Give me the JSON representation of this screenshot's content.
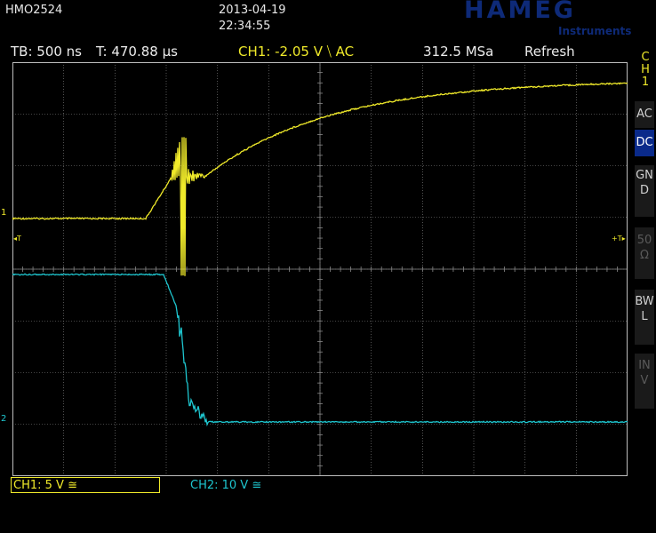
{
  "header": {
    "model": "HMO2524",
    "date": "2013-04-19",
    "time": "22:34:55",
    "brand": "HAMEG",
    "brand_sub": "Instruments"
  },
  "status": {
    "timebase": "TB: 500 ns",
    "trigger_time": "T: 470.88 µs",
    "ch1_trigger": "CH1: -2.05 V ⧹ AC",
    "sample_rate": "312.5 MSa",
    "mode": "Refresh"
  },
  "side_panel": {
    "channel_label": "CH1",
    "channel_lines": [
      "C",
      "H",
      "1"
    ],
    "buttons": [
      {
        "label": "AC",
        "state": "normal"
      },
      {
        "label": "DC",
        "state": "active"
      },
      {
        "label": "GND",
        "state": "normal"
      },
      {
        "label": "50Ω",
        "state": "dim"
      },
      {
        "label": "BWL",
        "state": "normal"
      },
      {
        "label": "INV",
        "state": "dim"
      }
    ]
  },
  "markers": {
    "ch1_ground": "1",
    "ch2_ground": "2",
    "trigger_left": "◂T",
    "trigger_right": "+T▸"
  },
  "bottom": {
    "ch1": "CH1: 5 V ≅",
    "ch2": "CH2: 10 V ≅"
  },
  "colors": {
    "ch1": "#f0ea2a",
    "ch2": "#1ec6cf",
    "grid": "#8a8a8a",
    "active_button": "#0a2a8a"
  }
}
